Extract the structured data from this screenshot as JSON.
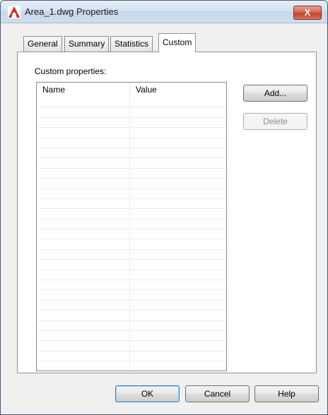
{
  "window": {
    "title": "Area_1.dwg Properties",
    "close_label": "X"
  },
  "tabs": [
    {
      "label": "General"
    },
    {
      "label": "Summary"
    },
    {
      "label": "Statistics"
    },
    {
      "label": "Custom",
      "active": true
    }
  ],
  "custom": {
    "section_label": "Custom properties:",
    "columns": {
      "name": "Name",
      "value": "Value"
    },
    "add_label": "Add...",
    "delete_label": "Delete"
  },
  "footer": {
    "ok_label": "OK",
    "cancel_label": "Cancel",
    "help_label": "Help"
  },
  "colors": {
    "accent": "#c24228",
    "titlebar": "#d4e2f1"
  },
  "icons": {
    "app": "autocad-icon",
    "close": "close-icon"
  }
}
